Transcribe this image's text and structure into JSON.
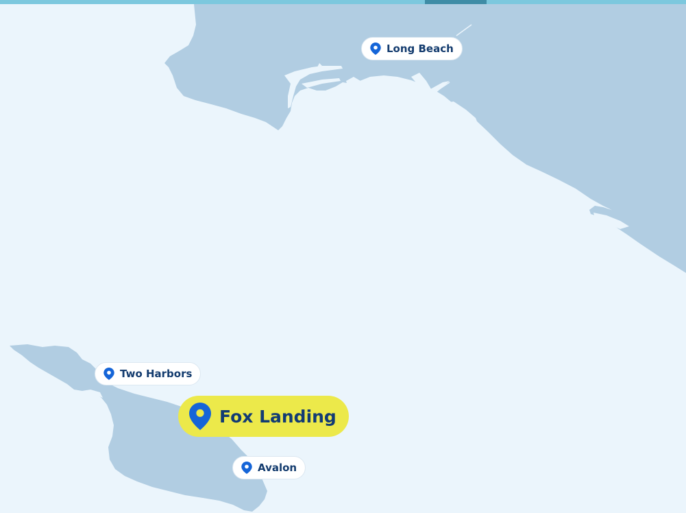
{
  "map": {
    "water_color": "#ebf5fc",
    "land_color": "#b1cde2",
    "top_strip_color": "#7cc8de"
  },
  "locations": [
    {
      "id": "long-beach",
      "label": "Long Beach",
      "icon": "location-pin-icon",
      "featured": false
    },
    {
      "id": "two-harbors",
      "label": "Two Harbors",
      "icon": "location-pin-icon",
      "featured": false
    },
    {
      "id": "fox-landing",
      "label": "Fox Landing",
      "icon": "location-pin-icon",
      "featured": true,
      "highlight_color": "#ece94a"
    },
    {
      "id": "avalon",
      "label": "Avalon",
      "icon": "location-pin-icon",
      "featured": false
    }
  ],
  "pin_color": "#1565d8"
}
